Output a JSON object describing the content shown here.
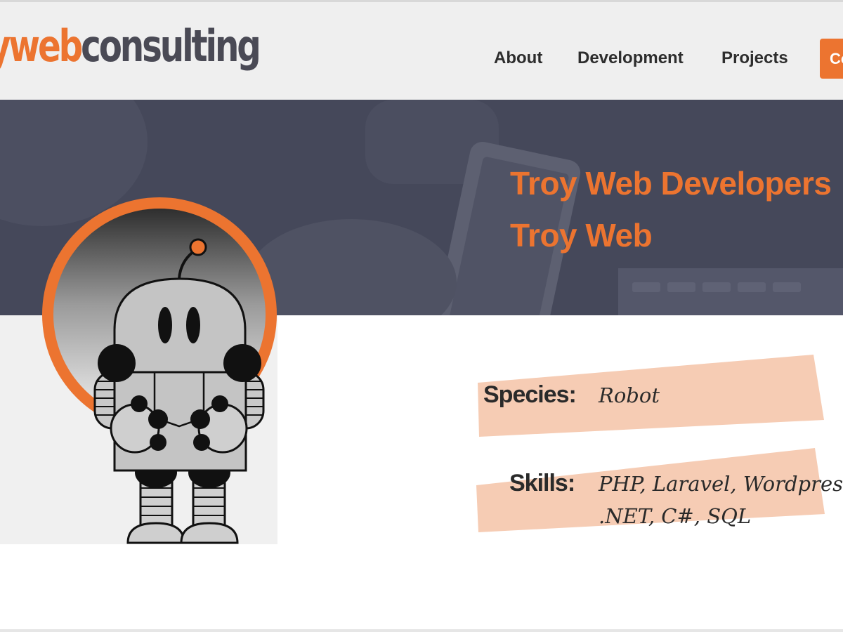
{
  "header": {
    "logo": {
      "part_a": "y",
      "part_b": "web",
      "part_c": "consulting"
    },
    "nav": [
      {
        "label": "About"
      },
      {
        "label": "Development"
      },
      {
        "label": "Projects"
      },
      {
        "label": "Co"
      }
    ]
  },
  "hero": {
    "title_line1": "Troy Web Developers",
    "title_line2": "Troy Web"
  },
  "profile": {
    "species_label": "Species:",
    "species_value": "Robot",
    "skills_label": "Skills:",
    "skills_line1": "PHP, Laravel, Wordpress,",
    "skills_line2": ".NET, C#, SQL"
  },
  "colors": {
    "accent": "#ec7430",
    "hero_bg": "#45485a",
    "header_bg": "#efefef",
    "highlight": "#f6ccb4"
  },
  "icons": [
    "robot-mascot-icon"
  ]
}
